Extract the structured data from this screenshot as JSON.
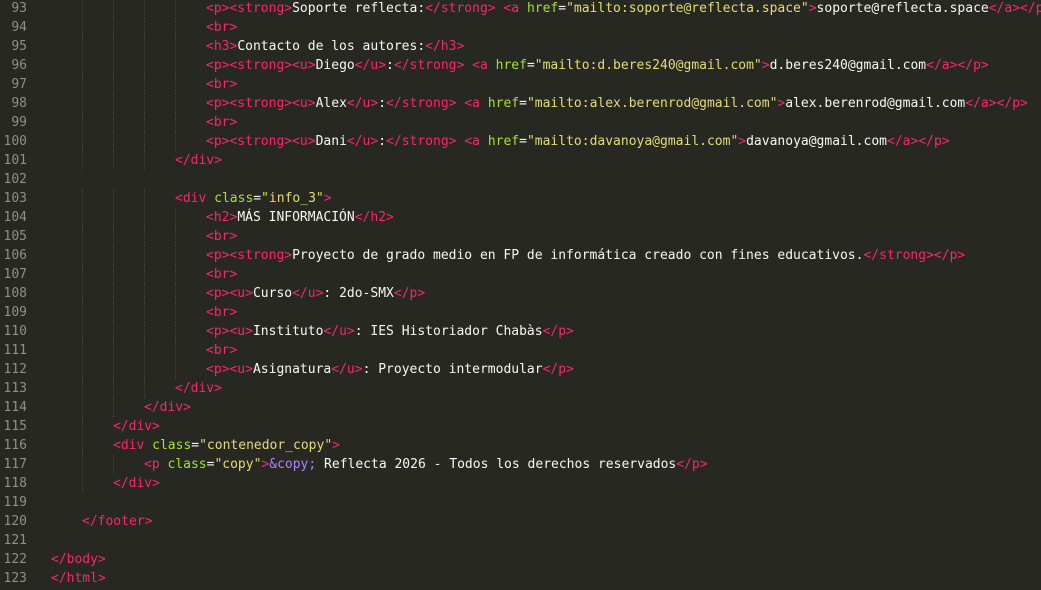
{
  "editor": {
    "theme": {
      "background": "#272822",
      "tag": "#f92672",
      "attribute": "#a6e22e",
      "string": "#e6db74",
      "entity": "#ae81ff",
      "text": "#f8f8f2",
      "line_number": "#90908a"
    },
    "lines": [
      {
        "n": "93",
        "indent": 5,
        "tokens": [
          [
            "tag",
            "<p>"
          ],
          [
            "tag",
            "<strong>"
          ],
          [
            "txt",
            "Soporte reflecta:"
          ],
          [
            "tag",
            "</strong>"
          ],
          [
            "txt",
            " "
          ],
          [
            "tag",
            "<a "
          ],
          [
            "attr",
            "href"
          ],
          [
            "txt",
            "="
          ],
          [
            "str",
            "\"mailto:soporte@reflecta.space\""
          ],
          [
            "tag",
            ">"
          ],
          [
            "txt",
            "soporte@reflecta.space"
          ],
          [
            "tag",
            "</a>"
          ],
          [
            "tag",
            "</p>"
          ]
        ]
      },
      {
        "n": "94",
        "indent": 5,
        "tokens": [
          [
            "tag",
            "<br>"
          ]
        ]
      },
      {
        "n": "95",
        "indent": 5,
        "tokens": [
          [
            "tag",
            "<h3>"
          ],
          [
            "txt",
            "Contacto de los autores:"
          ],
          [
            "tag",
            "</h3>"
          ]
        ]
      },
      {
        "n": "96",
        "indent": 5,
        "tokens": [
          [
            "tag",
            "<p>"
          ],
          [
            "tag",
            "<strong>"
          ],
          [
            "tag",
            "<u>"
          ],
          [
            "txt",
            "Diego"
          ],
          [
            "tag",
            "</u>"
          ],
          [
            "txt",
            ":"
          ],
          [
            "tag",
            "</strong>"
          ],
          [
            "txt",
            " "
          ],
          [
            "tag",
            "<a "
          ],
          [
            "attr",
            "href"
          ],
          [
            "txt",
            "="
          ],
          [
            "str",
            "\"mailto:d.beres240@gmail.com\""
          ],
          [
            "tag",
            ">"
          ],
          [
            "txt",
            "d.beres240@gmail.com"
          ],
          [
            "tag",
            "</a>"
          ],
          [
            "tag",
            "</p>"
          ]
        ]
      },
      {
        "n": "97",
        "indent": 5,
        "tokens": [
          [
            "tag",
            "<br>"
          ]
        ]
      },
      {
        "n": "98",
        "indent": 5,
        "tokens": [
          [
            "tag",
            "<p>"
          ],
          [
            "tag",
            "<strong>"
          ],
          [
            "tag",
            "<u>"
          ],
          [
            "txt",
            "Alex"
          ],
          [
            "tag",
            "</u>"
          ],
          [
            "txt",
            ":"
          ],
          [
            "tag",
            "</strong>"
          ],
          [
            "txt",
            " "
          ],
          [
            "tag",
            "<a "
          ],
          [
            "attr",
            "href"
          ],
          [
            "txt",
            "="
          ],
          [
            "str",
            "\"mailto:alex.berenrod@gmail.com\""
          ],
          [
            "tag",
            ">"
          ],
          [
            "txt",
            "alex.berenrod@gmail.com"
          ],
          [
            "tag",
            "</a>"
          ],
          [
            "tag",
            "</p>"
          ]
        ]
      },
      {
        "n": "99",
        "indent": 5,
        "tokens": [
          [
            "tag",
            "<br>"
          ]
        ]
      },
      {
        "n": "100",
        "indent": 5,
        "tokens": [
          [
            "tag",
            "<p>"
          ],
          [
            "tag",
            "<strong>"
          ],
          [
            "tag",
            "<u>"
          ],
          [
            "txt",
            "Dani"
          ],
          [
            "tag",
            "</u>"
          ],
          [
            "txt",
            ":"
          ],
          [
            "tag",
            "</strong>"
          ],
          [
            "txt",
            " "
          ],
          [
            "tag",
            "<a "
          ],
          [
            "attr",
            "href"
          ],
          [
            "txt",
            "="
          ],
          [
            "str",
            "\"mailto:davanoya@gmail.com\""
          ],
          [
            "tag",
            ">"
          ],
          [
            "txt",
            "davanoya@gmail.com"
          ],
          [
            "tag",
            "</a>"
          ],
          [
            "tag",
            "</p>"
          ]
        ]
      },
      {
        "n": "101",
        "indent": 4,
        "tokens": [
          [
            "tag",
            "</div>"
          ]
        ]
      },
      {
        "n": "102",
        "indent": 0,
        "tokens": []
      },
      {
        "n": "103",
        "indent": 4,
        "tokens": [
          [
            "tag",
            "<div "
          ],
          [
            "attr",
            "class"
          ],
          [
            "txt",
            "="
          ],
          [
            "str",
            "\"info_3\""
          ],
          [
            "tag",
            ">"
          ]
        ]
      },
      {
        "n": "104",
        "indent": 5,
        "tokens": [
          [
            "tag",
            "<h2>"
          ],
          [
            "txt",
            "MÁS INFORMACIÓN"
          ],
          [
            "tag",
            "</h2>"
          ]
        ]
      },
      {
        "n": "105",
        "indent": 5,
        "tokens": [
          [
            "tag",
            "<br>"
          ]
        ]
      },
      {
        "n": "106",
        "indent": 5,
        "tokens": [
          [
            "tag",
            "<p>"
          ],
          [
            "tag",
            "<strong>"
          ],
          [
            "txt",
            "Proyecto de grado medio en FP de informática creado con fines educativos."
          ],
          [
            "tag",
            "</strong>"
          ],
          [
            "tag",
            "</p>"
          ]
        ]
      },
      {
        "n": "107",
        "indent": 5,
        "tokens": [
          [
            "tag",
            "<br>"
          ]
        ]
      },
      {
        "n": "108",
        "indent": 5,
        "tokens": [
          [
            "tag",
            "<p>"
          ],
          [
            "tag",
            "<u>"
          ],
          [
            "txt",
            "Curso"
          ],
          [
            "tag",
            "</u>"
          ],
          [
            "txt",
            ": 2do-SMX"
          ],
          [
            "tag",
            "</p>"
          ]
        ]
      },
      {
        "n": "109",
        "indent": 5,
        "tokens": [
          [
            "tag",
            "<br>"
          ]
        ]
      },
      {
        "n": "110",
        "indent": 5,
        "tokens": [
          [
            "tag",
            "<p>"
          ],
          [
            "tag",
            "<u>"
          ],
          [
            "txt",
            "Instituto"
          ],
          [
            "tag",
            "</u>"
          ],
          [
            "txt",
            ": IES Historiador Chabàs"
          ],
          [
            "tag",
            "</p>"
          ]
        ]
      },
      {
        "n": "111",
        "indent": 5,
        "tokens": [
          [
            "tag",
            "<br>"
          ]
        ]
      },
      {
        "n": "112",
        "indent": 5,
        "tokens": [
          [
            "tag",
            "<p>"
          ],
          [
            "tag",
            "<u>"
          ],
          [
            "txt",
            "Asignatura"
          ],
          [
            "tag",
            "</u>"
          ],
          [
            "txt",
            ": Proyecto intermodular"
          ],
          [
            "tag",
            "</p>"
          ]
        ]
      },
      {
        "n": "113",
        "indent": 4,
        "tokens": [
          [
            "tag",
            "</div>"
          ]
        ]
      },
      {
        "n": "114",
        "indent": 3,
        "tokens": [
          [
            "tag",
            "</div>"
          ]
        ]
      },
      {
        "n": "115",
        "indent": 2,
        "tokens": [
          [
            "tag",
            "</div>"
          ]
        ]
      },
      {
        "n": "116",
        "indent": 2,
        "tokens": [
          [
            "tag",
            "<div "
          ],
          [
            "attr",
            "class"
          ],
          [
            "txt",
            "="
          ],
          [
            "str",
            "\"contenedor_copy\""
          ],
          [
            "tag",
            ">"
          ]
        ]
      },
      {
        "n": "117",
        "indent": 3,
        "tokens": [
          [
            "tag",
            "<p "
          ],
          [
            "attr",
            "class"
          ],
          [
            "txt",
            "="
          ],
          [
            "str",
            "\"copy\""
          ],
          [
            "tag",
            ">"
          ],
          [
            "ent",
            "&copy;"
          ],
          [
            "txt",
            " Reflecta 2026 - Todos los derechos reservados"
          ],
          [
            "tag",
            "</p>"
          ]
        ]
      },
      {
        "n": "118",
        "indent": 2,
        "tokens": [
          [
            "tag",
            "</div>"
          ]
        ]
      },
      {
        "n": "119",
        "indent": 0,
        "tokens": []
      },
      {
        "n": "120",
        "indent": 1,
        "tokens": [
          [
            "tag",
            "</footer>"
          ]
        ]
      },
      {
        "n": "121",
        "indent": 0,
        "tokens": []
      },
      {
        "n": "122",
        "indent": 0,
        "tokens": [
          [
            "tag",
            "</body>"
          ]
        ]
      },
      {
        "n": "123",
        "indent": 0,
        "tokens": [
          [
            "tag",
            "</html>"
          ]
        ]
      }
    ]
  }
}
